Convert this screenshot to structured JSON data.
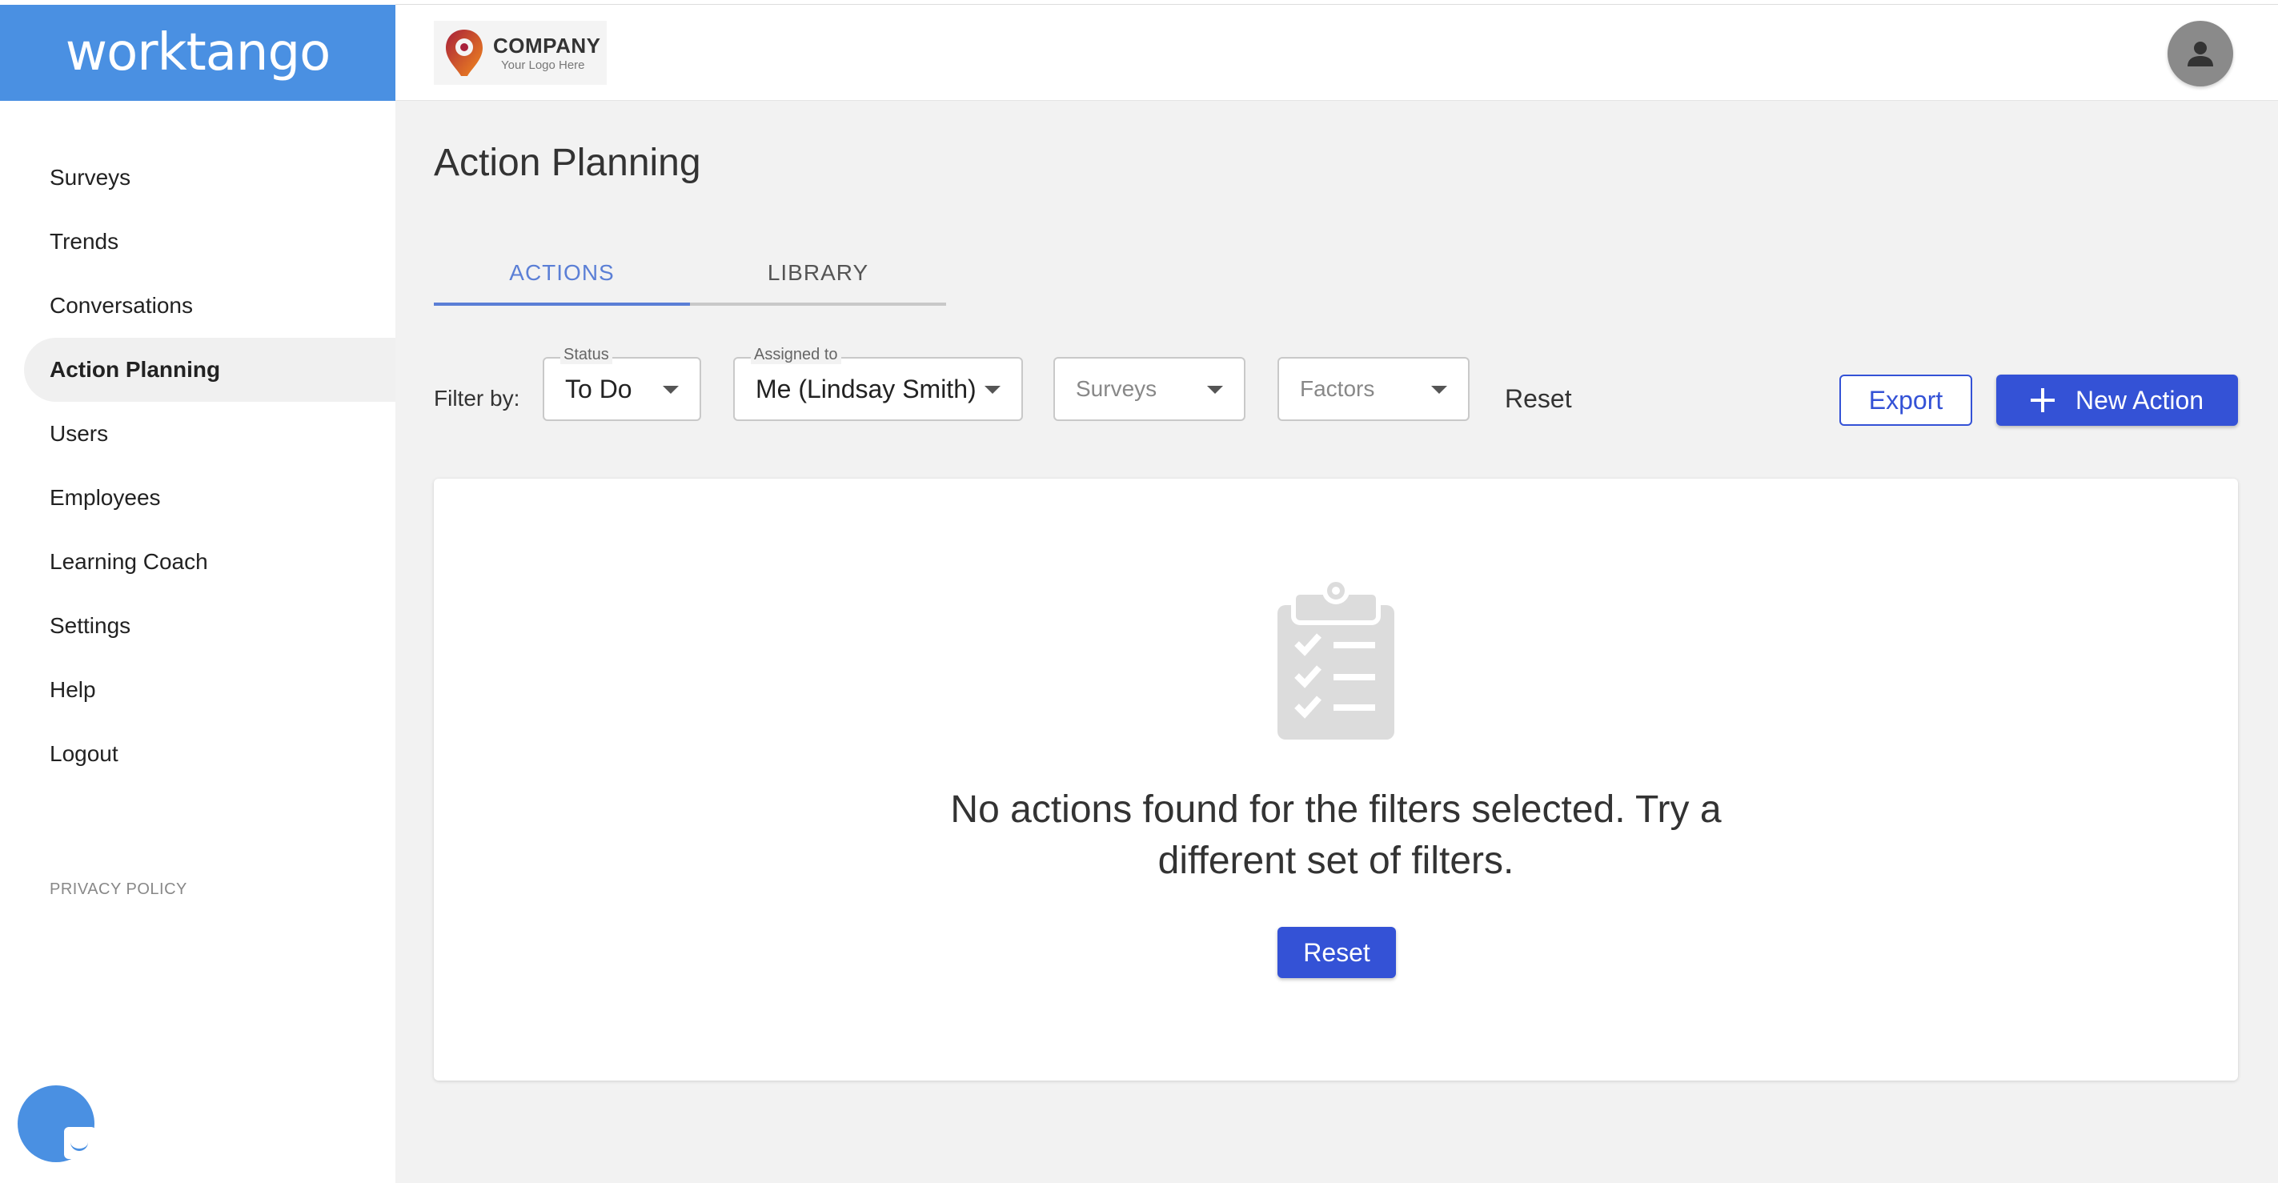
{
  "brand": {
    "name": "worktango"
  },
  "company": {
    "name": "COMPANY",
    "tagline": "Your Logo Here"
  },
  "sidebar": {
    "items": [
      {
        "label": "Surveys"
      },
      {
        "label": "Trends"
      },
      {
        "label": "Conversations"
      },
      {
        "label": "Action Planning",
        "active": true
      },
      {
        "label": "Users"
      },
      {
        "label": "Employees"
      },
      {
        "label": "Learning Coach"
      },
      {
        "label": "Settings"
      },
      {
        "label": "Help"
      },
      {
        "label": "Logout"
      }
    ],
    "privacy": "PRIVACY POLICY"
  },
  "page": {
    "title": "Action Planning"
  },
  "tabs": [
    {
      "label": "ACTIONS",
      "active": true
    },
    {
      "label": "LIBRARY"
    }
  ],
  "filters": {
    "label": "Filter by:",
    "status": {
      "legend": "Status",
      "value": "To Do"
    },
    "assigned": {
      "legend": "Assigned to",
      "value": "Me (Lindsay Smith)"
    },
    "surveys": {
      "placeholder": "Surveys"
    },
    "factors": {
      "placeholder": "Factors"
    },
    "reset": "Reset"
  },
  "toolbar": {
    "export_label": "Export",
    "new_action_label": "New Action"
  },
  "empty_state": {
    "line1": "No actions found for the filters selected. Try a",
    "line2": "different set of filters.",
    "reset_label": "Reset"
  },
  "colors": {
    "brand": "#4a90e2",
    "accent": "#3452d6",
    "tab_active": "#5b7fd6"
  },
  "icons": {
    "avatar": "person-icon",
    "empty": "clipboard-checklist-icon",
    "new_action": "plus-icon",
    "dropdown": "chevron-down-icon",
    "chat": "chat-bubble-icon"
  }
}
